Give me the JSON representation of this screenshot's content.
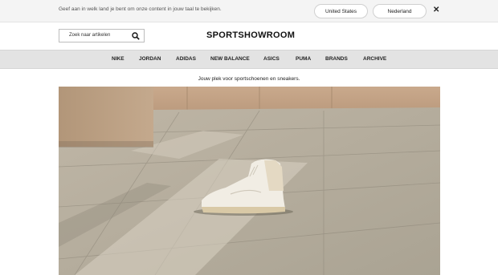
{
  "locale_bar": {
    "message": "Geef aan in welk land je bent om onze content in jouw taal te bekijken.",
    "options": [
      "United States",
      "Nederland"
    ],
    "close_icon": "close-icon"
  },
  "header": {
    "search_placeholder": "Zoek naar artikelen",
    "search_icon": "search-icon",
    "logo": "SPORTSHOWROOM"
  },
  "nav": {
    "items": [
      "NIKE",
      "JORDAN",
      "ADIDAS",
      "NEW BALANCE",
      "ASICS",
      "PUMA",
      "BRANDS",
      "ARCHIVE"
    ]
  },
  "tagline": "Jouw plek voor sportschoenen en sneakers.",
  "hero": {
    "image_subject": "sneaker-photo"
  }
}
